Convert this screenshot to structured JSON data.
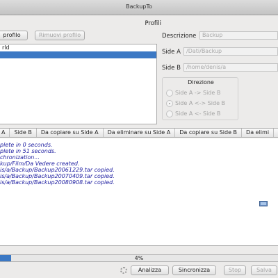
{
  "window": {
    "title": "BackupTo"
  },
  "profiles": {
    "title": "Profili",
    "add_button": "profilo",
    "remove_button": "Rimuovi profilo",
    "items": [
      {
        "label": "rld",
        "selected": false
      },
      {
        "label": "",
        "selected": true
      }
    ]
  },
  "details": {
    "description_label": "Descrizione",
    "description_value": "Backup",
    "side_a_label": "Side A",
    "side_a_value": "/Dati/Backup",
    "side_b_label": "Side B",
    "side_b_value": "/home/denis/a"
  },
  "direction": {
    "title": "Direzione",
    "options": [
      {
        "label": "Side A -> Side B",
        "selected": false
      },
      {
        "label": "Side A <-> Side B",
        "selected": true
      },
      {
        "label": "Side A <- Side B",
        "selected": false
      }
    ]
  },
  "tabs": [
    "A",
    "Side B",
    "Da copiare su Side A",
    "Da eliminare su Side A",
    "Da copiare su Side B",
    "Da elimi"
  ],
  "log": [
    "plete in 0 seconds.",
    "plete in 51 seconds.",
    "chronization...",
    "kup/Film/Da Vedere created.",
    "is/a/Backup/Backup20061229.tar copied.",
    "is/a/Backup/Backup20070409.tar copied.",
    "is/a/Backup/Backup20080908.tar copied."
  ],
  "progress": {
    "value": 0.04,
    "label": "4%"
  },
  "actions": {
    "analyze": "Analizza",
    "sync": "Sincronizza",
    "stop": "Stop",
    "save": "Salva"
  },
  "colors": {
    "selection": "#3b78c4",
    "log_text": "#2323a3"
  }
}
